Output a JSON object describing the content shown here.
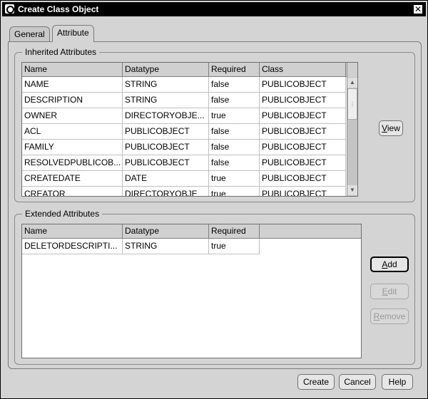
{
  "window": {
    "title": "Create Class Object",
    "close_glyph": "✕"
  },
  "tabs": [
    {
      "label": "General",
      "active": false
    },
    {
      "label": "Attribute",
      "active": true
    }
  ],
  "inherited": {
    "group_title": "Inherited Attributes",
    "columns": [
      "Name",
      "Datatype",
      "Required",
      "Class"
    ],
    "rows": [
      [
        "NAME",
        "STRING",
        "false",
        "PUBLICOBJECT"
      ],
      [
        "DESCRIPTION",
        "STRING",
        "false",
        "PUBLICOBJECT"
      ],
      [
        "OWNER",
        "DIRECTORYOBJE...",
        "true",
        "PUBLICOBJECT"
      ],
      [
        "ACL",
        "PUBLICOBJECT",
        "false",
        "PUBLICOBJECT"
      ],
      [
        "FAMILY",
        "PUBLICOBJECT",
        "false",
        "PUBLICOBJECT"
      ],
      [
        "RESOLVEDPUBLICOB...",
        "PUBLICOBJECT",
        "false",
        "PUBLICOBJECT"
      ],
      [
        "CREATEDATE",
        "DATE",
        "true",
        "PUBLICOBJECT"
      ],
      [
        "CREATOR",
        "DIRECTORYOBJE",
        "true",
        "PUBLICOBJECT"
      ]
    ],
    "view_button": {
      "mnemonic": "V",
      "rest": "iew"
    }
  },
  "extended": {
    "group_title": "Extended Attributes",
    "columns": [
      "Name",
      "Datatype",
      "Required"
    ],
    "rows": [
      [
        "DELETORDESCRIPTI...",
        "STRING",
        "true"
      ]
    ],
    "add_button": {
      "mnemonic": "A",
      "rest": "dd"
    },
    "edit_button": {
      "mnemonic": "E",
      "rest": "dit"
    },
    "remove_button": {
      "mnemonic": "R",
      "rest": "emove"
    }
  },
  "footer": {
    "create_label": "Create",
    "cancel_label": "Cancel",
    "help_label": "Help"
  },
  "icons": {
    "window_icon": "oracle-logo-icon",
    "close": "close-icon",
    "scroll_up": "scroll-up-arrow-icon",
    "scroll_down": "scroll-down-arrow-icon"
  }
}
